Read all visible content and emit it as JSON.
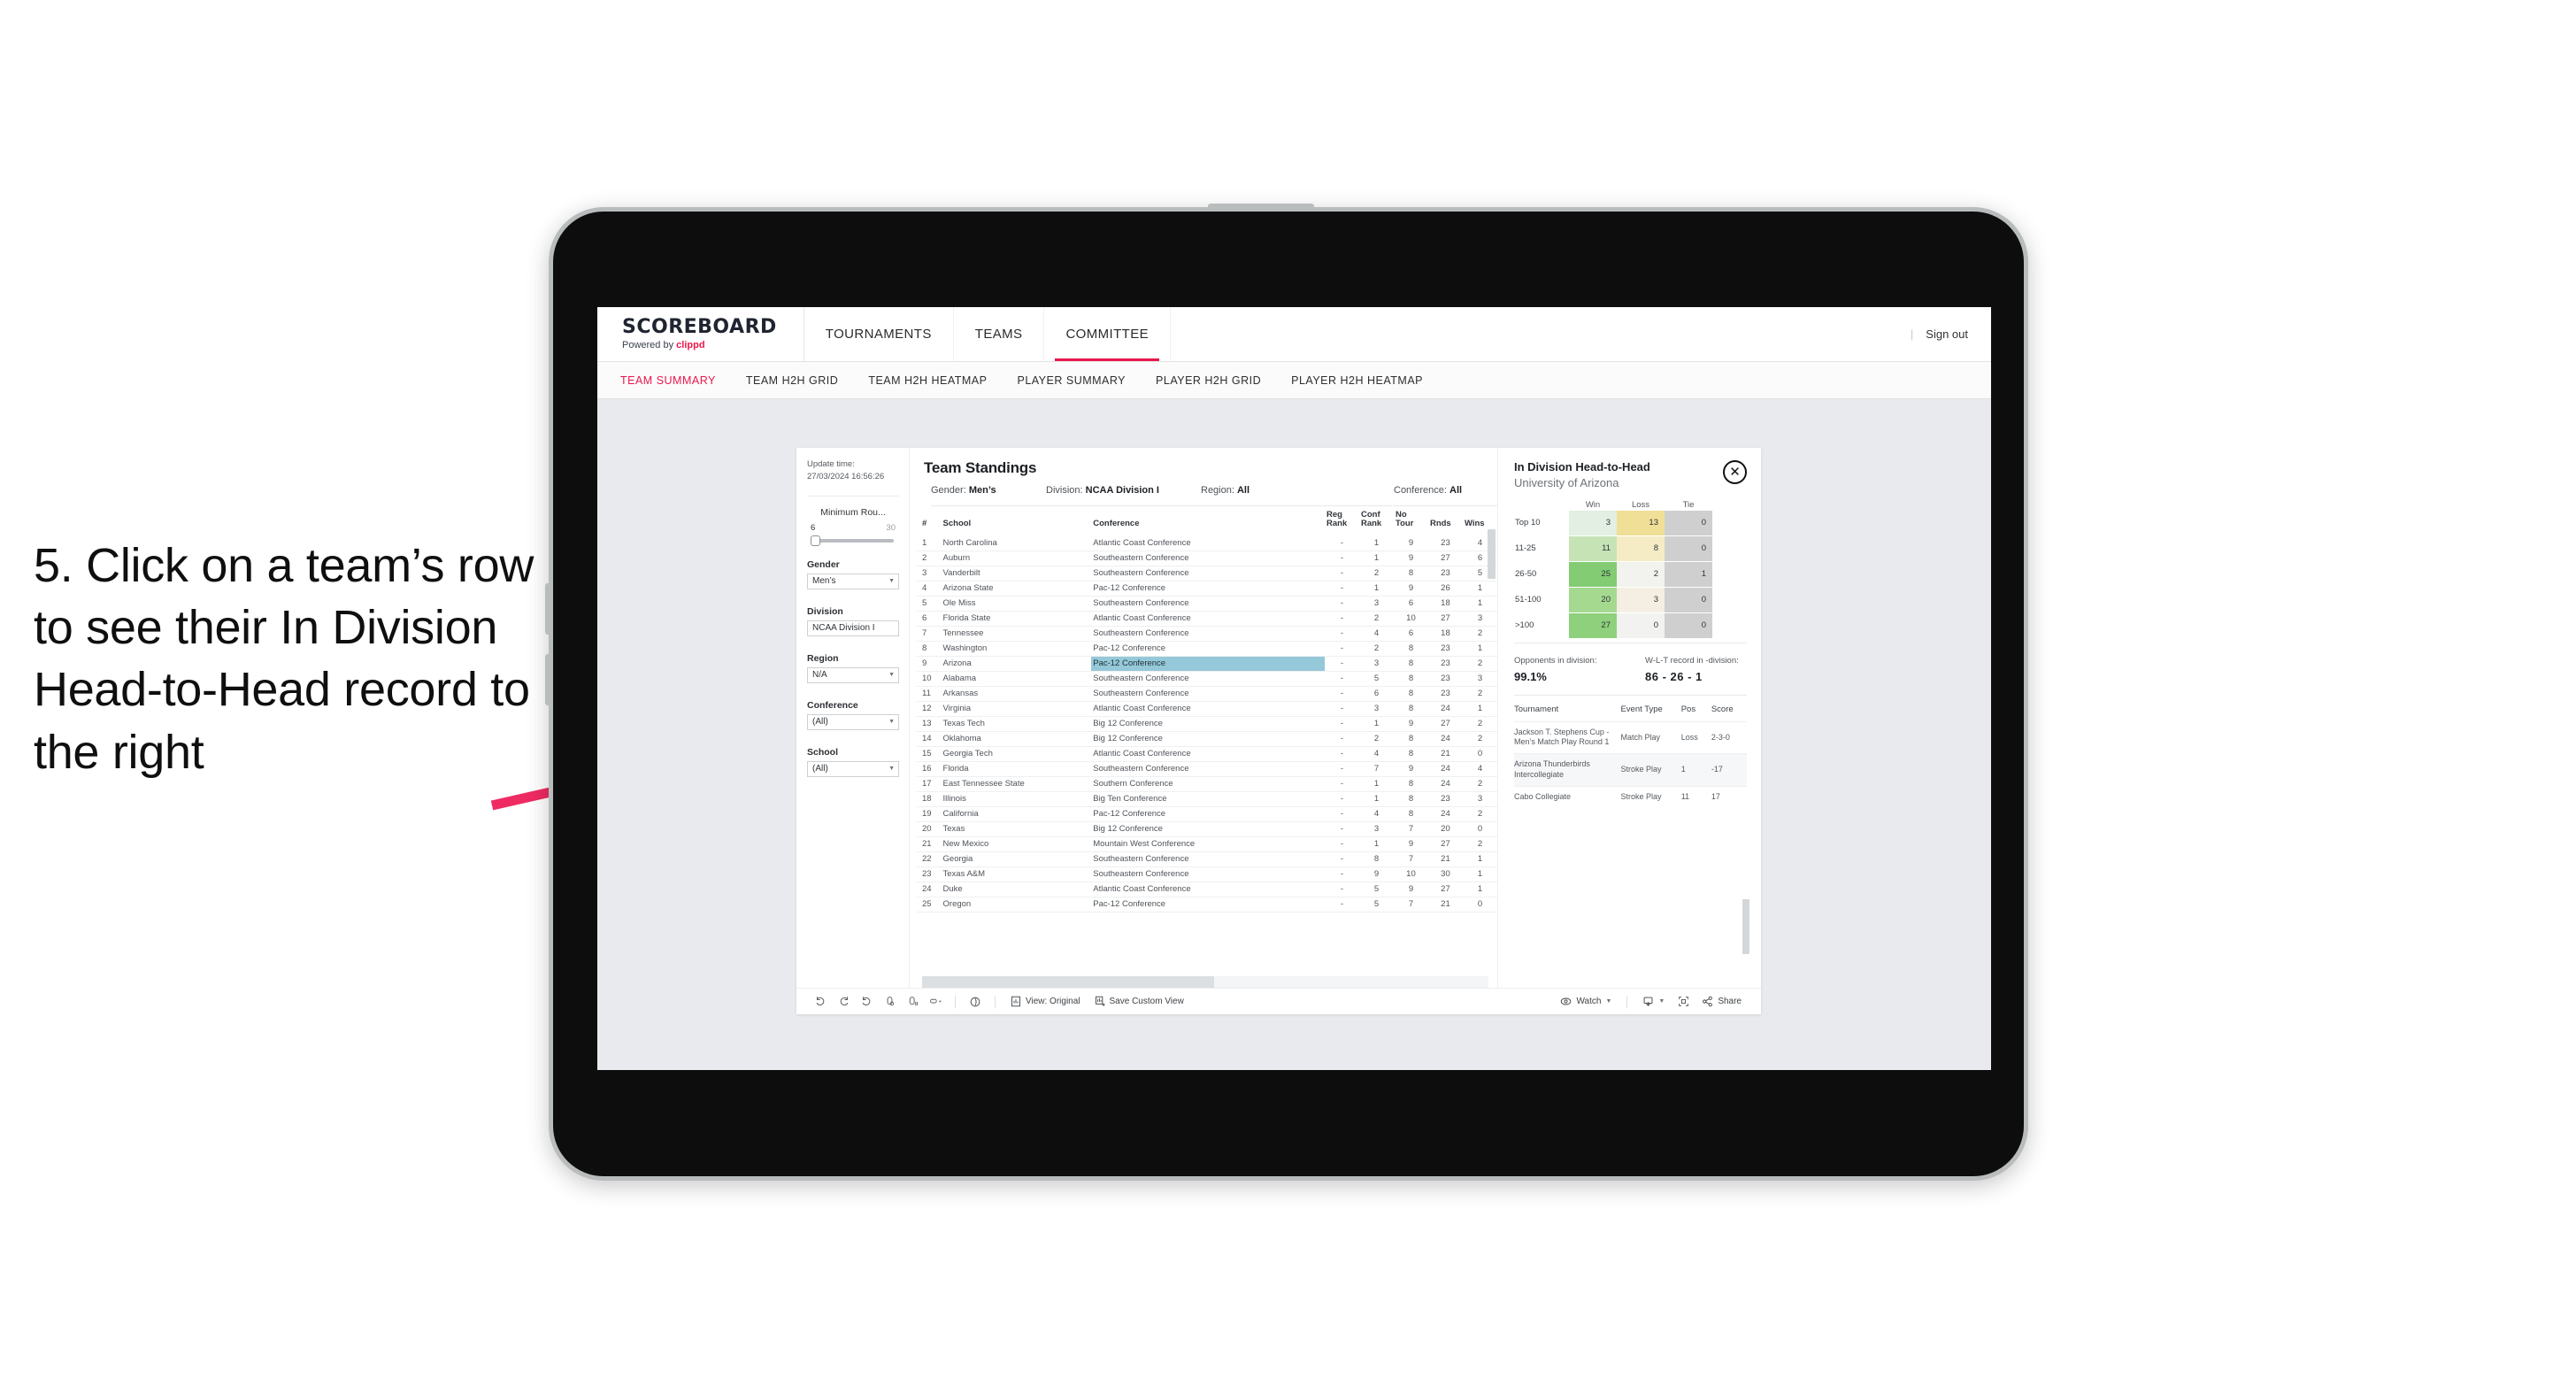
{
  "annotation": {
    "text": "5. Click on a team’s row to see their In Division Head-to-Head record to the right",
    "arrow_color": "#ef2b63"
  },
  "header": {
    "brand_title": "SCOREBOARD",
    "brand_sub_prefix": "Powered by ",
    "brand_sub_name": "clippd",
    "nav": [
      {
        "label": "TOURNAMENTS",
        "active": false
      },
      {
        "label": "TEAMS",
        "active": false
      },
      {
        "label": "COMMITTEE",
        "active": true
      }
    ],
    "divider": "|",
    "sign_out": "Sign out"
  },
  "subnav": {
    "items": [
      {
        "label": "TEAM SUMMARY",
        "active": true
      },
      {
        "label": "TEAM H2H GRID",
        "active": false
      },
      {
        "label": "TEAM H2H HEATMAP",
        "active": false
      },
      {
        "label": "PLAYER SUMMARY",
        "active": false
      },
      {
        "label": "PLAYER H2H GRID",
        "active": false
      },
      {
        "label": "PLAYER H2H HEATMAP",
        "active": false
      }
    ]
  },
  "rail": {
    "update_label": "Update time:",
    "update_value": "27/03/2024 16:56:26",
    "slider": {
      "title": "Minimum Rou...",
      "min": "6",
      "max": "30"
    },
    "fields": [
      {
        "label": "Gender",
        "value": "Men’s"
      },
      {
        "label": "Division",
        "value": "NCAA Division I"
      },
      {
        "label": "Region",
        "value": "N/A"
      },
      {
        "label": "Conference",
        "value": "(All)"
      },
      {
        "label": "School",
        "value": "(All)"
      }
    ]
  },
  "standings": {
    "title": "Team Standings",
    "filters": [
      {
        "label": "Gender:",
        "value": "Men’s"
      },
      {
        "label": "Division:",
        "value": "NCAA Division I"
      },
      {
        "label": "Region:",
        "value": "All"
      },
      {
        "label": "Conference:",
        "value": "All"
      }
    ],
    "columns": [
      "#",
      "School",
      "Conference",
      "Reg Rank",
      "Conf Rank",
      "No Tour",
      "Rnds",
      "Wins"
    ],
    "column_heads": {
      "num": "#",
      "school": "School",
      "conference": "Conference",
      "reg_rank": "Reg\nRank",
      "conf_rank": "Conf\nRank",
      "no_tour": "No\nTour",
      "rnds": "Rnds",
      "wins": "Wins"
    },
    "selected_row_index": 8,
    "rows": [
      {
        "num": "1",
        "school": "North Carolina",
        "conference": "Atlantic Coast Conference",
        "reg_rank": "-",
        "conf_rank": "1",
        "no_tour": "9",
        "rnds": "23",
        "wins": "4"
      },
      {
        "num": "2",
        "school": "Auburn",
        "conference": "Southeastern Conference",
        "reg_rank": "-",
        "conf_rank": "1",
        "no_tour": "9",
        "rnds": "27",
        "wins": "6"
      },
      {
        "num": "3",
        "school": "Vanderbilt",
        "conference": "Southeastern Conference",
        "reg_rank": "-",
        "conf_rank": "2",
        "no_tour": "8",
        "rnds": "23",
        "wins": "5"
      },
      {
        "num": "4",
        "school": "Arizona State",
        "conference": "Pac-12 Conference",
        "reg_rank": "-",
        "conf_rank": "1",
        "no_tour": "9",
        "rnds": "26",
        "wins": "1"
      },
      {
        "num": "5",
        "school": "Ole Miss",
        "conference": "Southeastern Conference",
        "reg_rank": "-",
        "conf_rank": "3",
        "no_tour": "6",
        "rnds": "18",
        "wins": "1"
      },
      {
        "num": "6",
        "school": "Florida State",
        "conference": "Atlantic Coast Conference",
        "reg_rank": "-",
        "conf_rank": "2",
        "no_tour": "10",
        "rnds": "27",
        "wins": "3"
      },
      {
        "num": "7",
        "school": "Tennessee",
        "conference": "Southeastern Conference",
        "reg_rank": "-",
        "conf_rank": "4",
        "no_tour": "6",
        "rnds": "18",
        "wins": "2"
      },
      {
        "num": "8",
        "school": "Washington",
        "conference": "Pac-12 Conference",
        "reg_rank": "-",
        "conf_rank": "2",
        "no_tour": "8",
        "rnds": "23",
        "wins": "1"
      },
      {
        "num": "9",
        "school": "Arizona",
        "conference": "Pac-12 Conference",
        "reg_rank": "-",
        "conf_rank": "3",
        "no_tour": "8",
        "rnds": "23",
        "wins": "2"
      },
      {
        "num": "10",
        "school": "Alabama",
        "conference": "Southeastern Conference",
        "reg_rank": "-",
        "conf_rank": "5",
        "no_tour": "8",
        "rnds": "23",
        "wins": "3"
      },
      {
        "num": "11",
        "school": "Arkansas",
        "conference": "Southeastern Conference",
        "reg_rank": "-",
        "conf_rank": "6",
        "no_tour": "8",
        "rnds": "23",
        "wins": "2"
      },
      {
        "num": "12",
        "school": "Virginia",
        "conference": "Atlantic Coast Conference",
        "reg_rank": "-",
        "conf_rank": "3",
        "no_tour": "8",
        "rnds": "24",
        "wins": "1"
      },
      {
        "num": "13",
        "school": "Texas Tech",
        "conference": "Big 12 Conference",
        "reg_rank": "-",
        "conf_rank": "1",
        "no_tour": "9",
        "rnds": "27",
        "wins": "2"
      },
      {
        "num": "14",
        "school": "Oklahoma",
        "conference": "Big 12 Conference",
        "reg_rank": "-",
        "conf_rank": "2",
        "no_tour": "8",
        "rnds": "24",
        "wins": "2"
      },
      {
        "num": "15",
        "school": "Georgia Tech",
        "conference": "Atlantic Coast Conference",
        "reg_rank": "-",
        "conf_rank": "4",
        "no_tour": "8",
        "rnds": "21",
        "wins": "0"
      },
      {
        "num": "16",
        "school": "Florida",
        "conference": "Southeastern Conference",
        "reg_rank": "-",
        "conf_rank": "7",
        "no_tour": "9",
        "rnds": "24",
        "wins": "4"
      },
      {
        "num": "17",
        "school": "East Tennessee State",
        "conference": "Southern Conference",
        "reg_rank": "-",
        "conf_rank": "1",
        "no_tour": "8",
        "rnds": "24",
        "wins": "2"
      },
      {
        "num": "18",
        "school": "Illinois",
        "conference": "Big Ten Conference",
        "reg_rank": "-",
        "conf_rank": "1",
        "no_tour": "8",
        "rnds": "23",
        "wins": "3"
      },
      {
        "num": "19",
        "school": "California",
        "conference": "Pac-12 Conference",
        "reg_rank": "-",
        "conf_rank": "4",
        "no_tour": "8",
        "rnds": "24",
        "wins": "2"
      },
      {
        "num": "20",
        "school": "Texas",
        "conference": "Big 12 Conference",
        "reg_rank": "-",
        "conf_rank": "3",
        "no_tour": "7",
        "rnds": "20",
        "wins": "0"
      },
      {
        "num": "21",
        "school": "New Mexico",
        "conference": "Mountain West Conference",
        "reg_rank": "-",
        "conf_rank": "1",
        "no_tour": "9",
        "rnds": "27",
        "wins": "2"
      },
      {
        "num": "22",
        "school": "Georgia",
        "conference": "Southeastern Conference",
        "reg_rank": "-",
        "conf_rank": "8",
        "no_tour": "7",
        "rnds": "21",
        "wins": "1"
      },
      {
        "num": "23",
        "school": "Texas A&M",
        "conference": "Southeastern Conference",
        "reg_rank": "-",
        "conf_rank": "9",
        "no_tour": "10",
        "rnds": "30",
        "wins": "1"
      },
      {
        "num": "24",
        "school": "Duke",
        "conference": "Atlantic Coast Conference",
        "reg_rank": "-",
        "conf_rank": "5",
        "no_tour": "9",
        "rnds": "27",
        "wins": "1"
      },
      {
        "num": "25",
        "school": "Oregon",
        "conference": "Pac-12 Conference",
        "reg_rank": "-",
        "conf_rank": "5",
        "no_tour": "7",
        "rnds": "21",
        "wins": "0"
      }
    ]
  },
  "h2h": {
    "title": "In Division Head-to-Head",
    "subtitle": "University of Arizona",
    "close_label": "✕",
    "chart_data": {
      "type": "heatmap",
      "title": "In Division Head-to-Head",
      "subtitle": "University of Arizona",
      "columns": [
        "Win",
        "Loss",
        "Tie"
      ],
      "rows": [
        "Top 10",
        "11-25",
        "26-50",
        "51-100",
        ">100"
      ],
      "values": [
        [
          3,
          13,
          0
        ],
        [
          11,
          8,
          0
        ],
        [
          25,
          2,
          1
        ],
        [
          20,
          3,
          0
        ],
        [
          27,
          0,
          0
        ]
      ],
      "cell_colors": [
        [
          "#e2efe2",
          "#f0df96",
          "#cfcfcf"
        ],
        [
          "#c6e3b6",
          "#f5ecc6",
          "#cfcfcf"
        ],
        [
          "#83cc74",
          "#f2f2ee",
          "#cfcfcf"
        ],
        [
          "#a5d98f",
          "#f4efe2",
          "#cfcfcf"
        ],
        [
          "#8ed07b",
          "#f2f2f0",
          "#cfcfcf"
        ]
      ],
      "legend": "none",
      "grid": false
    },
    "stats": [
      {
        "label": "Opponents in division:",
        "value": "99.1%"
      },
      {
        "label": "W-L-T record in -division:",
        "value": "86 - 26 - 1"
      }
    ],
    "tournament_columns": [
      "Tournament",
      "Event Type",
      "Pos",
      "Score"
    ],
    "tournaments": [
      {
        "name": "Jackson T. Stephens Cup - Men’s Match Play Round 1",
        "type": "Match Play",
        "pos": "Loss",
        "score": "2-3-0"
      },
      {
        "name": "Arizona Thunderbirds Intercollegiate",
        "type": "Stroke Play",
        "pos": "1",
        "score": "-17"
      },
      {
        "name": "Cabo Collegiate",
        "type": "Stroke Play",
        "pos": "11",
        "score": "17"
      }
    ]
  },
  "toolbar": {
    "view_label": "View: Original",
    "save_label": "Save Custom View",
    "watch_label": "Watch",
    "share_label": "Share",
    "icons": [
      "undo-icon",
      "redo-icon",
      "revert-icon",
      "refresh-icon",
      "pause-icon",
      "highlight-icon"
    ]
  }
}
